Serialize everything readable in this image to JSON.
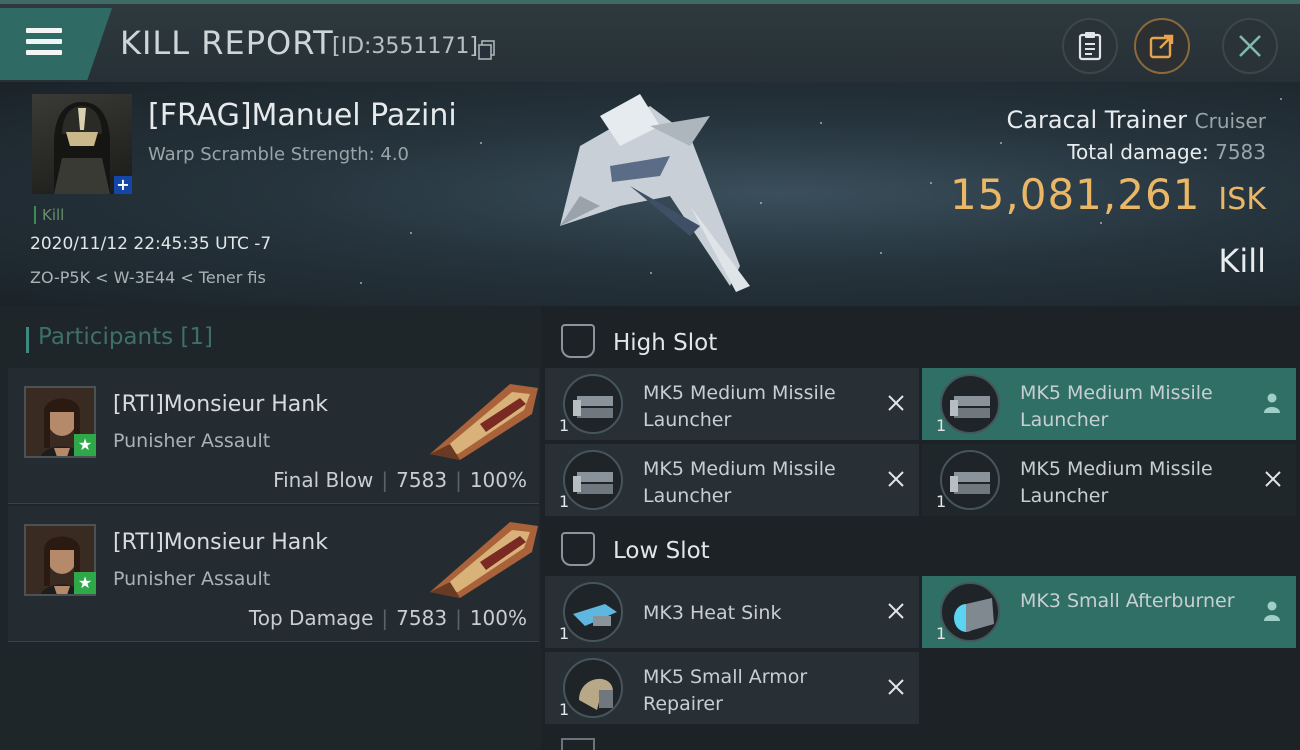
{
  "header": {
    "title": "KILL REPORT",
    "report_id": "[ID:3551171]",
    "icons": [
      "menu-icon",
      "copy-icon",
      "clipboard-icon",
      "share-icon",
      "close-icon"
    ]
  },
  "victim": {
    "name": "[FRAG]Manuel Pazini",
    "warp_scramble": "Warp Scramble Strength: 4.0",
    "tag": "Kill",
    "time": "2020/11/12 22:45:35 UTC -7",
    "location": "ZO-P5K < W-3E44 < Tener fis",
    "ship_name": "Caracal Trainer",
    "ship_class": "Cruiser",
    "total_damage_label": "Total damage:",
    "total_damage_value": "7583",
    "isk_value": "15,081,261",
    "isk_unit": "ISK",
    "result": "Kill"
  },
  "participants": {
    "header": "Participants [1]",
    "rows": [
      {
        "name": "[RTI]Monsieur Hank",
        "ship": "Punisher Assault",
        "role": "Final Blow",
        "damage": "7583",
        "percent": "100%"
      },
      {
        "name": "[RTI]Monsieur Hank",
        "ship": "Punisher Assault",
        "role": "Top Damage",
        "damage": "7583",
        "percent": "100%"
      }
    ]
  },
  "fitting": {
    "high_slot_label": "High Slot",
    "low_slot_label": "Low Slot",
    "high": [
      {
        "qty": "1",
        "name": "MK5 Medium Missile Launcher",
        "state": "destroyed"
      },
      {
        "qty": "1",
        "name": "MK5 Medium Missile Launcher",
        "state": "dropped"
      },
      {
        "qty": "1",
        "name": "MK5 Medium Missile Launcher",
        "state": "destroyed"
      },
      {
        "qty": "1",
        "name": "MK5 Medium Missile Launcher",
        "state": "destroyed"
      }
    ],
    "low": [
      {
        "qty": "1",
        "name": "MK3 Heat Sink",
        "state": "destroyed"
      },
      {
        "qty": "1",
        "name": "MK3 Small Afterburner",
        "state": "dropped"
      },
      {
        "qty": "1",
        "name": "MK5 Small Armor Repairer",
        "state": "destroyed"
      }
    ]
  },
  "colors": {
    "accent_teal": "#2f6f66",
    "isk_gold": "#e9b765",
    "badge_green": "#2fa84a",
    "badge_blue": "#1446a8"
  }
}
